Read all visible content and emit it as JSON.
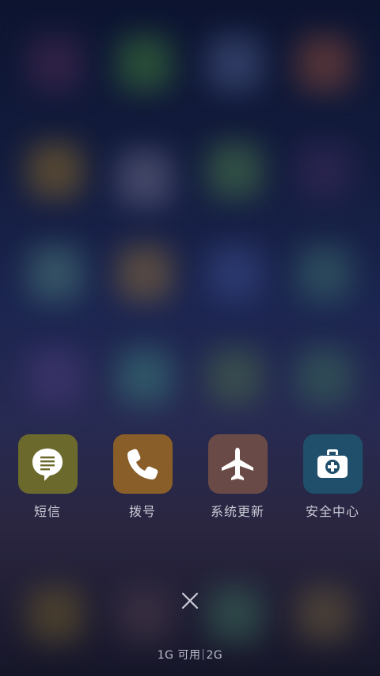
{
  "colors": {
    "sms_icon_bg": "#6b6a2c",
    "dialer_icon_bg": "#8a5e28",
    "update_icon_bg": "#6a4a47",
    "security_icon_bg": "#1f4f6a",
    "label_text": "#c9cbd6"
  },
  "apps": [
    {
      "label": "短信",
      "icon": "message-bubble-icon"
    },
    {
      "label": "拨号",
      "icon": "phone-icon"
    },
    {
      "label": "系统更新",
      "icon": "airplane-icon"
    },
    {
      "label": "安全中心",
      "icon": "medical-kit-icon"
    }
  ],
  "close": {
    "icon": "close-icon"
  },
  "memory": {
    "available": "1G 可用",
    "total": "2G"
  }
}
